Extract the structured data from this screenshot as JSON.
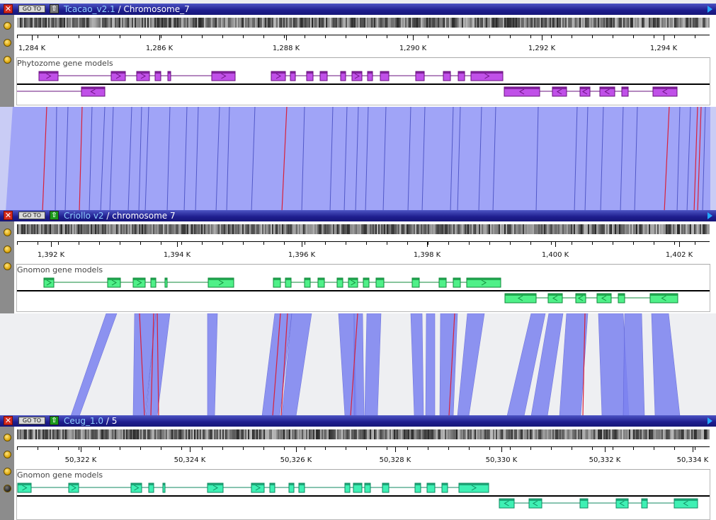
{
  "panels": [
    {
      "organism": "Tcacao_v2.1",
      "chromosome": "Chromosome_7",
      "goto_label": "GO TO",
      "up_icon_color": "#7a7a7a",
      "track_name": "Phytozome gene models",
      "gene_fill": "#c050e8",
      "gene_stroke": "#6a107f",
      "ticks": [
        "1,284 K",
        "1,286 K",
        "1,288 K",
        "1,290 K",
        "1,292 K",
        "1,294 K"
      ],
      "dots": 3
    },
    {
      "organism": "Criollo v2",
      "chromosome": "chromosome 7",
      "goto_label": "GO TO",
      "up_icon_color": "#1b9a1b",
      "track_name": "Gnomon gene models",
      "gene_fill": "#4ff088",
      "gene_stroke": "#0f8a3a",
      "ticks": [
        "1,392 K",
        "1,394 K",
        "1,396 K",
        "1,398 K",
        "1,400 K",
        "1,402 K"
      ],
      "dots": 3
    },
    {
      "organism": "Ceug_1.0",
      "chromosome": "5",
      "goto_label": "GO TO",
      "up_icon_color": "#1b9a1b",
      "track_name": "Gnomon gene models",
      "gene_fill": "#3ff0b4",
      "gene_stroke": "#0f8a60",
      "ticks": [
        "50,322 K",
        "50,324 K",
        "50,326 K",
        "50,328 K",
        "50,330 K",
        "50,332 K",
        "50,334 K"
      ],
      "dots": 4
    }
  ],
  "separator": "/",
  "colors": {
    "synteny_fill": "#9fa3f7",
    "synteny_line": "#5158c8",
    "synteny_red": "#d8203a",
    "titlebar": "#1e1d8e",
    "close": "#d62a1c"
  }
}
